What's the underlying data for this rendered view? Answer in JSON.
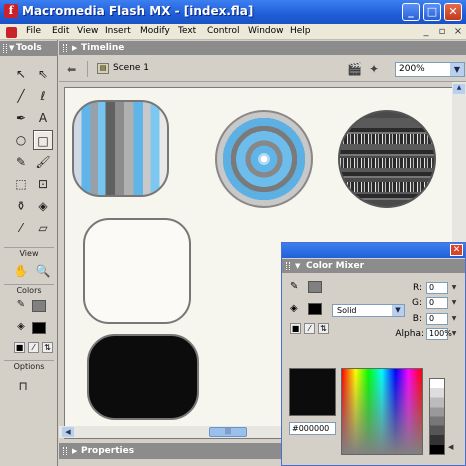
{
  "window": {
    "title": "Macromedia Flash MX - [index.fla]",
    "minimize_icon": "minimize-icon",
    "maximize_icon": "maximize-icon",
    "close_icon": "close-icon"
  },
  "menubar": {
    "items": [
      "File",
      "Edit",
      "View",
      "Insert",
      "Modify",
      "Text",
      "Control",
      "Window",
      "Help"
    ]
  },
  "tools_panel": {
    "title": "Tools",
    "view_label": "View",
    "colors_label": "Colors",
    "options_label": "Options",
    "tool_icons": [
      "arrow-icon",
      "subselect-icon",
      "line-icon",
      "lasso-icon",
      "pen-icon",
      "text-icon",
      "oval-icon",
      "rectangle-icon",
      "pencil-icon",
      "brush-icon",
      "free-transform-icon",
      "fill-transform-icon",
      "ink-bottle-icon",
      "paint-bucket-icon",
      "eyedropper-icon",
      "eraser-icon",
      "hand-icon",
      "zoom-icon"
    ],
    "stroke_color": "#808080",
    "fill_color": "#000000"
  },
  "timeline": {
    "title": "Timeline"
  },
  "scenebar": {
    "scene_label": "Scene 1",
    "zoom_value": "200%"
  },
  "stage": {
    "shapes": [
      "striped-rounded-rect",
      "concentric-circle",
      "patterned-circle",
      "empty-rounded-rect",
      "black-rounded-rect"
    ]
  },
  "color_mixer": {
    "title": "Color Mixer",
    "fill_type": "Solid",
    "r_label": "R:",
    "g_label": "G:",
    "b_label": "B:",
    "alpha_label": "Alpha:",
    "r_value": "0",
    "g_value": "0",
    "b_value": "0",
    "alpha_value": "100%",
    "hex_value": "#000000"
  },
  "properties": {
    "title": "Properties"
  }
}
